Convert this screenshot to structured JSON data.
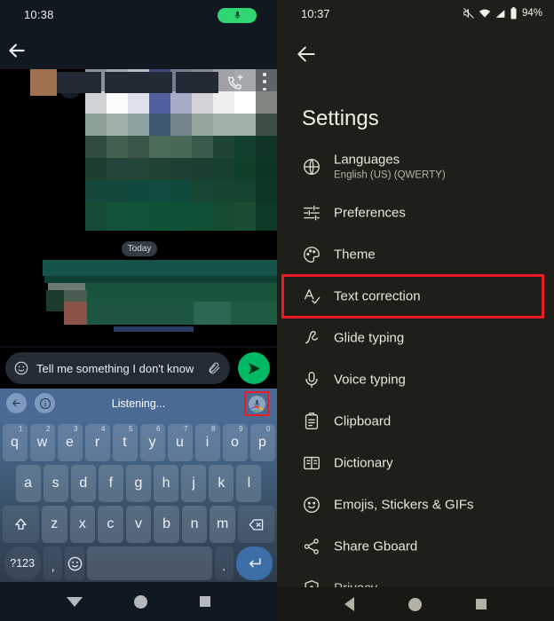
{
  "left": {
    "status": {
      "time": "10:38",
      "mic_indicator_icon": "microphone-icon"
    },
    "appbar": {
      "back_icon": "back-arrow-icon",
      "add_call_icon": "add-call-icon",
      "overflow_icon": "more-vert-icon",
      "contact_name": ""
    },
    "chat": {
      "date_divider": "Today",
      "sender_avatar_icon": "reply-arrow-icon"
    },
    "composer": {
      "emoji_icon": "emoji-icon",
      "message_text": "Tell me something I don't know",
      "attach_icon": "paperclip-icon",
      "send_icon": "send-icon"
    },
    "voice_bar": {
      "back_icon": "back-arrow-icon",
      "info_icon": "info-icon",
      "status_text": "Listening...",
      "mic_icon": "microphone-icon"
    },
    "keyboard": {
      "row1": [
        {
          "key": "q",
          "num": "1"
        },
        {
          "key": "w",
          "num": "2"
        },
        {
          "key": "e",
          "num": "3"
        },
        {
          "key": "r",
          "num": "4"
        },
        {
          "key": "t",
          "num": "5"
        },
        {
          "key": "y",
          "num": "6"
        },
        {
          "key": "u",
          "num": "7"
        },
        {
          "key": "i",
          "num": "8"
        },
        {
          "key": "o",
          "num": "9"
        },
        {
          "key": "p",
          "num": "0"
        }
      ],
      "row2": [
        "a",
        "s",
        "d",
        "f",
        "g",
        "h",
        "j",
        "k",
        "l"
      ],
      "row3": {
        "shift_icon": "shift-icon",
        "keys": [
          "z",
          "x",
          "c",
          "v",
          "b",
          "n",
          "m"
        ],
        "backspace_icon": "backspace-icon"
      },
      "row4": {
        "symbols_label": "?123",
        "comma": ",",
        "emoji_icon": "emoji-icon",
        "space": "",
        "period": ".",
        "enter_icon": "enter-icon"
      }
    },
    "navbar": {
      "back_icon": "dismiss-keyboard-icon",
      "home_icon": "home-icon",
      "recents_icon": "recents-icon"
    }
  },
  "right": {
    "status": {
      "time": "10:37",
      "mute_icon": "mute-icon",
      "wifi_icon": "wifi-icon",
      "signal_icon": "signal-icon",
      "battery_icon": "battery-icon",
      "battery_level": "94%"
    },
    "back_icon": "back-arrow-icon",
    "title": "Settings",
    "items": [
      {
        "label": "Languages",
        "sub": "English (US) (QWERTY)",
        "icon": "globe-icon"
      },
      {
        "label": "Preferences",
        "sub": "",
        "icon": "tune-icon"
      },
      {
        "label": "Theme",
        "sub": "",
        "icon": "palette-icon"
      },
      {
        "label": "Text correction",
        "sub": "",
        "icon": "spellcheck-icon"
      },
      {
        "label": "Glide typing",
        "sub": "",
        "icon": "gesture-icon"
      },
      {
        "label": "Voice typing",
        "sub": "",
        "icon": "microphone-icon"
      },
      {
        "label": "Clipboard",
        "sub": "",
        "icon": "clipboard-icon"
      },
      {
        "label": "Dictionary",
        "sub": "",
        "icon": "book-icon"
      },
      {
        "label": "Emojis, Stickers & GIFs",
        "sub": "",
        "icon": "emoji-icon"
      },
      {
        "label": "Share Gboard",
        "sub": "",
        "icon": "share-icon"
      },
      {
        "label": "Privacy",
        "sub": "",
        "icon": "shield-icon"
      }
    ],
    "highlight": {
      "target_label": "Text correction",
      "color": "#ee1b24"
    },
    "navbar": {
      "back_icon": "back-icon",
      "home_icon": "home-icon",
      "recents_icon": "recents-icon"
    }
  },
  "colors": {
    "highlight_red": "#ee1b24",
    "send_green": "#00b964",
    "mic_pill_green": "#2fd671",
    "voice_bar_blue": "#4a6a93",
    "right_bg": "#1f1f19",
    "left_bg": "#0d1117"
  }
}
